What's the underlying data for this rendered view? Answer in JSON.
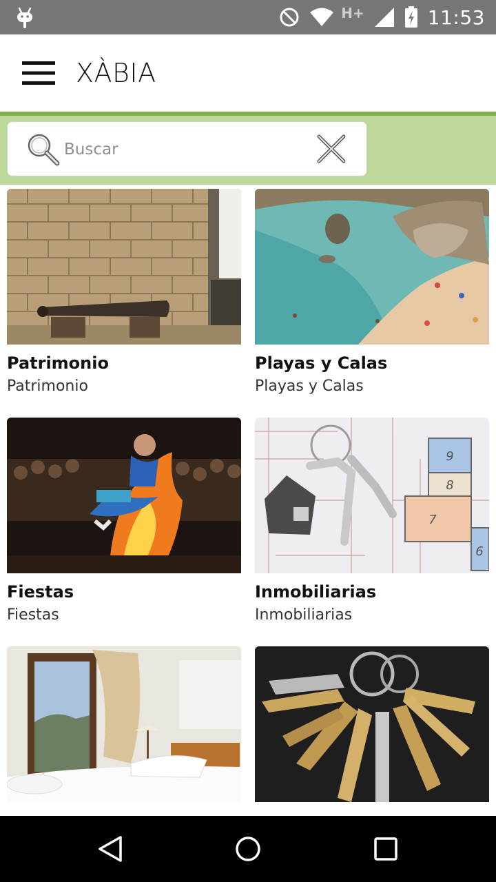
{
  "status_bar": {
    "time": "11:53",
    "network": "H+",
    "icons": [
      "android-icon",
      "do-not-disturb-icon",
      "wifi-icon",
      "signal-icon",
      "battery-charging-icon"
    ]
  },
  "app_bar": {
    "title": "XÀBIA",
    "menu_icon": "hamburger-menu-icon"
  },
  "search": {
    "placeholder": "Buscar",
    "value": "",
    "search_icon": "search-icon",
    "clear_icon": "close-icon"
  },
  "categories": [
    {
      "title": "Patrimonio",
      "subtitle": "Patrimonio",
      "image": "cannon-wall-photo"
    },
    {
      "title": "Playas y Calas",
      "subtitle": "Playas y Calas",
      "image": "beach-cove-photo"
    },
    {
      "title": "Fiestas",
      "subtitle": "Fiestas",
      "image": "bonfire-festival-photo"
    },
    {
      "title": "Inmobiliarias",
      "subtitle": "Inmobiliarias",
      "image": "keys-floorplan-photo"
    },
    {
      "title": "",
      "subtitle": "",
      "image": "hotel-room-photo"
    },
    {
      "title": "",
      "subtitle": "",
      "image": "keys-bunch-photo"
    }
  ],
  "nav_bar": {
    "back": "back-icon",
    "home": "home-icon",
    "recents": "recents-icon"
  },
  "colors": {
    "status_bar": "#767676",
    "accent_green": "#7fb050",
    "search_band": "#bdd89a",
    "nav_bar": "#000000"
  }
}
